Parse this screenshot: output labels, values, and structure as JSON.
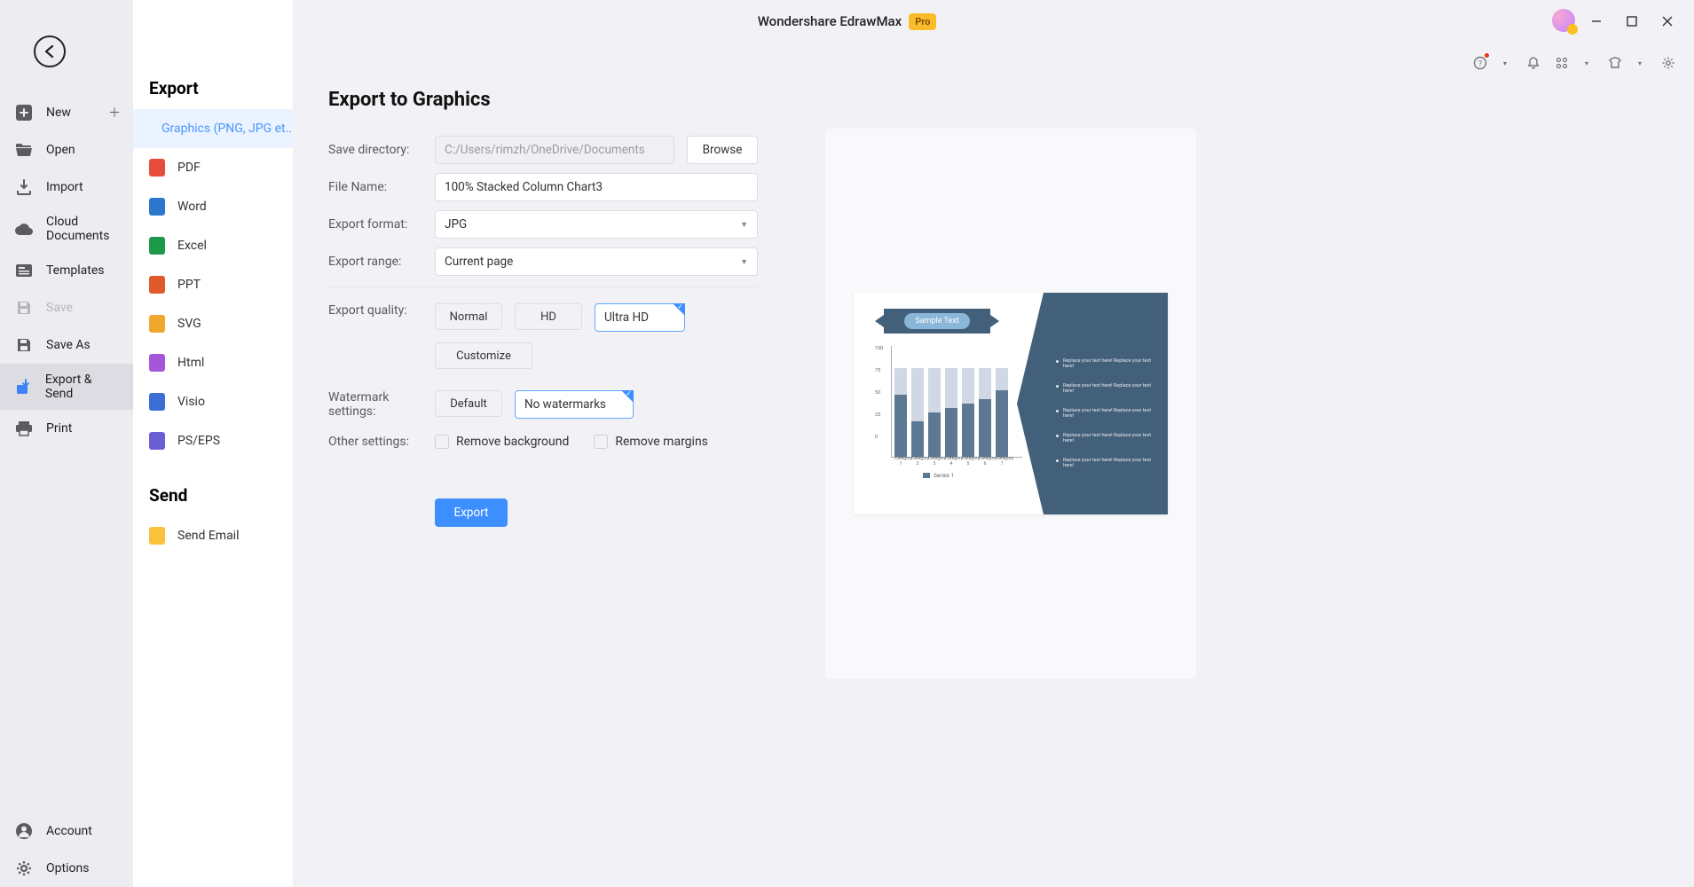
{
  "app": {
    "title": "Wondershare EdrawMax",
    "badge": "Pro"
  },
  "sidebar1": {
    "items": [
      {
        "key": "new",
        "label": "New",
        "hasPlus": true
      },
      {
        "key": "open",
        "label": "Open"
      },
      {
        "key": "import",
        "label": "Import"
      },
      {
        "key": "cloud",
        "label": "Cloud Documents"
      },
      {
        "key": "templates",
        "label": "Templates"
      },
      {
        "key": "save",
        "label": "Save",
        "disabled": true
      },
      {
        "key": "saveas",
        "label": "Save As"
      },
      {
        "key": "export",
        "label": "Export & Send",
        "active": true
      },
      {
        "key": "print",
        "label": "Print"
      }
    ],
    "bottom": [
      {
        "key": "account",
        "label": "Account"
      },
      {
        "key": "options",
        "label": "Options"
      }
    ]
  },
  "sidebar2": {
    "exportHeading": "Export",
    "sendHeading": "Send",
    "formats": [
      {
        "key": "graphics",
        "label": "Graphics (PNG, JPG et...",
        "color": "#46b9ed",
        "active": true
      },
      {
        "key": "pdf",
        "label": "PDF",
        "color": "#e74c3c"
      },
      {
        "key": "word",
        "label": "Word",
        "color": "#2b77cb"
      },
      {
        "key": "excel",
        "label": "Excel",
        "color": "#1e994a"
      },
      {
        "key": "ppt",
        "label": "PPT",
        "color": "#e05a2b"
      },
      {
        "key": "svg",
        "label": "SVG",
        "color": "#f0a72d"
      },
      {
        "key": "html",
        "label": "Html",
        "color": "#a657d9"
      },
      {
        "key": "visio",
        "label": "Visio",
        "color": "#3b6fd6"
      },
      {
        "key": "pseps",
        "label": "PS/EPS",
        "color": "#6b5dd3"
      }
    ],
    "send": [
      {
        "key": "email",
        "label": "Send Email",
        "color": "#f8c23a"
      }
    ]
  },
  "form": {
    "heading": "Export to Graphics",
    "labels": {
      "dir": "Save directory:",
      "filename": "File Name:",
      "format": "Export format:",
      "range": "Export range:",
      "quality": "Export quality:",
      "watermark": "Watermark settings:",
      "other": "Other settings:"
    },
    "dir": "C:/Users/rimzh/OneDrive/Documents",
    "browse": "Browse",
    "filename": "100% Stacked Column Chart3",
    "format": "JPG",
    "range": "Current page",
    "quality": {
      "normal": "Normal",
      "hd": "HD",
      "ultra": "Ultra HD",
      "custom": "Customize"
    },
    "watermark": {
      "default": "Default",
      "none": "No watermarks"
    },
    "checks": {
      "bg": "Remove background",
      "margins": "Remove margins"
    },
    "exportBtn": "Export"
  },
  "preview": {
    "ribbon": "Sample Text",
    "bullets": [
      "Replace your text here! Replace your text here!",
      "Replace your text here! Replace your text here!",
      "Replace your text here! Replace your text here!",
      "Replace your text here! Replace your text here!",
      "Replace your text here! Replace your text here!"
    ],
    "legend": "Series 1",
    "yTicks": [
      "100",
      "75",
      "50",
      "25",
      "0"
    ]
  },
  "chart_data": {
    "type": "bar",
    "title": "Sample Text",
    "categories": [
      "Category 1",
      "Category 2",
      "Category 3",
      "Category 4",
      "Category 5",
      "Category 6",
      "Category 7"
    ],
    "series": [
      {
        "name": "Series 1",
        "values": [
          70,
          40,
          50,
          55,
          60,
          65,
          75
        ]
      }
    ],
    "stacked_top_values": [
      30,
      60,
      50,
      45,
      40,
      35,
      25
    ],
    "ylabel": "",
    "xlabel": "",
    "ylim": [
      0,
      100
    ]
  }
}
